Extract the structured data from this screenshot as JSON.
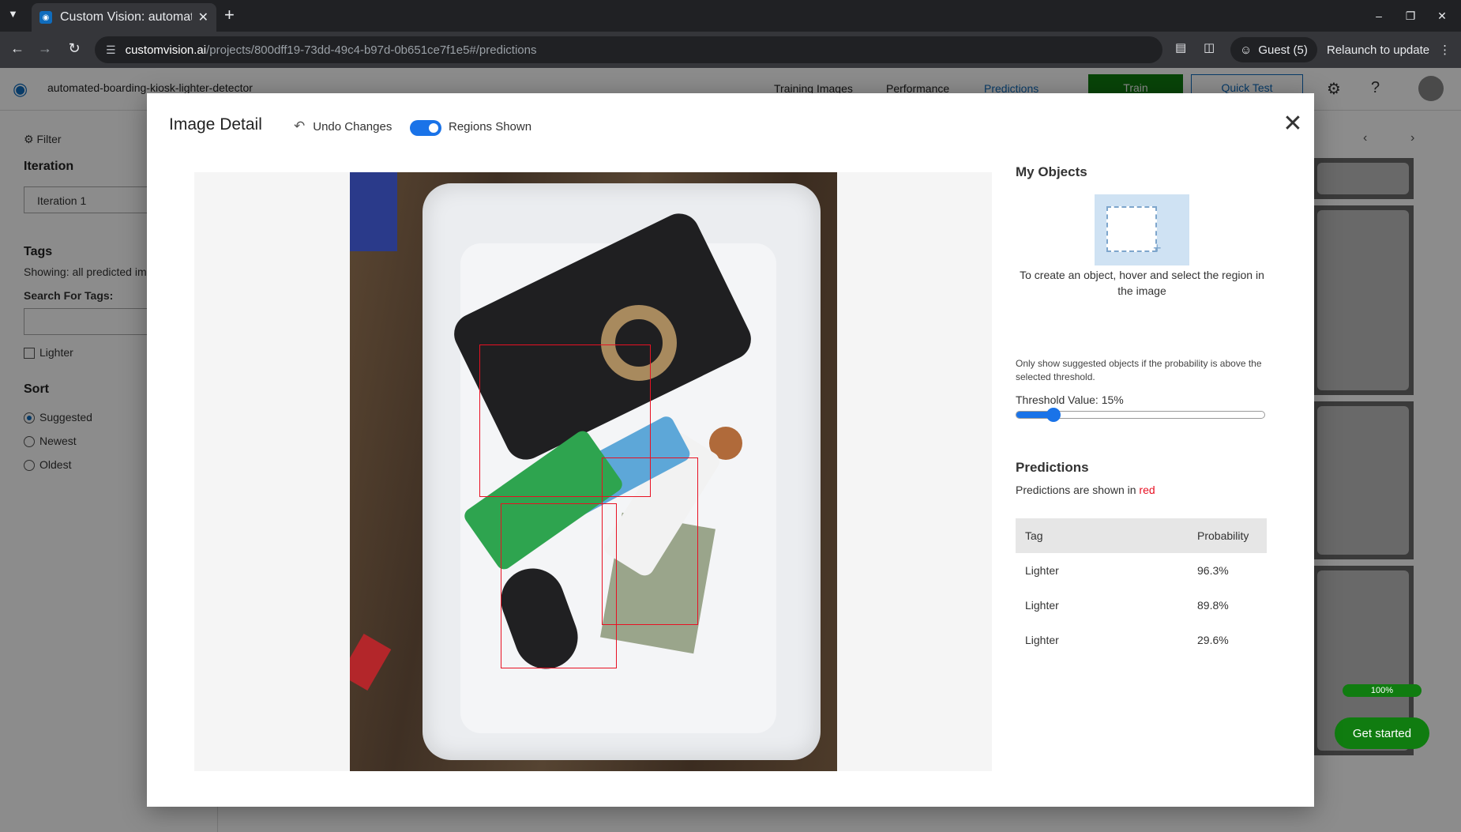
{
  "browser": {
    "tab_title": "Custom Vision: automat",
    "url_host": "customvision.ai",
    "url_path": "/projects/800dff19-73dd-49c4-b97d-0b651ce7f1e5#/predictions",
    "guest_label": "Guest (5)",
    "relaunch_label": "Relaunch to update"
  },
  "app": {
    "project_name": "automated-boarding-kiosk-lighter-detector",
    "nav": [
      "Training Images",
      "Performance",
      "Predictions"
    ],
    "active_nav": "Predictions",
    "train_label": "Train",
    "quick_test_label": "Quick Test",
    "sidebar": {
      "filter_label": "Filter",
      "iteration_heading": "Iteration",
      "iteration_value": "Iteration 1",
      "tags_heading": "Tags",
      "showing_text": "Showing: all predicted im",
      "search_label": "Search For Tags:",
      "tag_items": [
        "Lighter"
      ],
      "sort_heading": "Sort",
      "sort_options": [
        "Suggested",
        "Newest",
        "Oldest"
      ],
      "sort_selected": "Suggested"
    },
    "progress_label": "100%",
    "get_started_label": "Get started"
  },
  "modal": {
    "title": "Image Detail",
    "undo_label": "Undo Changes",
    "regions_label": "Regions Shown",
    "regions_shown": true,
    "my_objects_heading": "My Objects",
    "my_objects_help": "To create an object, hover and select the region in the image",
    "threshold_note": "Only show suggested objects if the probability is above the selected threshold.",
    "threshold_label": "Threshold Value: 15%",
    "threshold_value": 15,
    "predictions_heading": "Predictions",
    "predictions_note_prefix": "Predictions are shown in",
    "predictions_note_color_word": "red",
    "table_headers": [
      "Tag",
      "Probability"
    ],
    "predictions": [
      {
        "tag": "Lighter",
        "probability": "96.3%"
      },
      {
        "tag": "Lighter",
        "probability": "89.8%"
      },
      {
        "tag": "Lighter",
        "probability": "29.6%"
      }
    ]
  },
  "colors": {
    "accent_blue": "#1a73e8",
    "brand_green": "#107c10",
    "prediction_red": "#e81123"
  },
  "icons": [
    "tab-list-icon",
    "favicon-icon",
    "close-tab-icon",
    "new-tab-icon",
    "minimize-icon",
    "restore-icon",
    "close-window-icon",
    "back-icon",
    "forward-icon",
    "reload-icon",
    "site-info-icon",
    "cast-icon",
    "side-panel-icon",
    "profile-icon",
    "menu-icon",
    "eye-logo-icon",
    "gear-icon",
    "help-icon",
    "filter-icon",
    "undo-icon",
    "close-icon"
  ]
}
